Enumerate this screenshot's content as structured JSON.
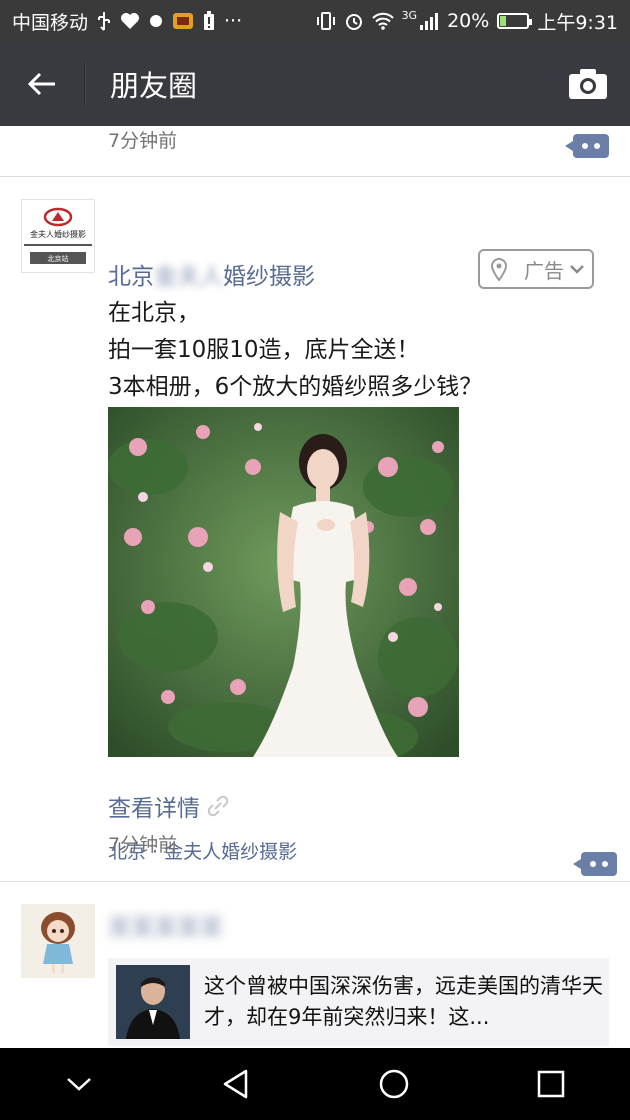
{
  "status_bar": {
    "carrier": "中国移动",
    "network": "3G",
    "battery_percent": "20%",
    "battery_level": 0.2,
    "time": "上午9:31",
    "more": "···"
  },
  "header": {
    "title": "朋友圈",
    "back_icon": "back-arrow-icon",
    "camera_icon": "camera-icon"
  },
  "colors": {
    "header_bg": "#393a3f",
    "link": "#576b95",
    "time_text": "#737373"
  },
  "feed": {
    "previous_post": {
      "time": "7分钟前"
    },
    "ad_post": {
      "name_start": "北京",
      "name_blurred": "金夫人",
      "name_end": "婚纱摄影",
      "avatar_brand": "金夫人婚纱摄影",
      "avatar_sub": "北京站",
      "ad_label": "广告",
      "text_lines": [
        "在北京，",
        "拍一套10服10造，底片全送！",
        "3本相册，6个放大的婚纱照多少钱？"
      ],
      "detail_link": "查看详情",
      "location": "北京 · 金夫人婚纱摄影",
      "time": "7分钟前"
    },
    "next_post": {
      "name_blurred": "某某某某某",
      "share_title": "这个曾被中国深深伤害，远走美国的清华天才，却在9年前突然归来！这..."
    }
  }
}
